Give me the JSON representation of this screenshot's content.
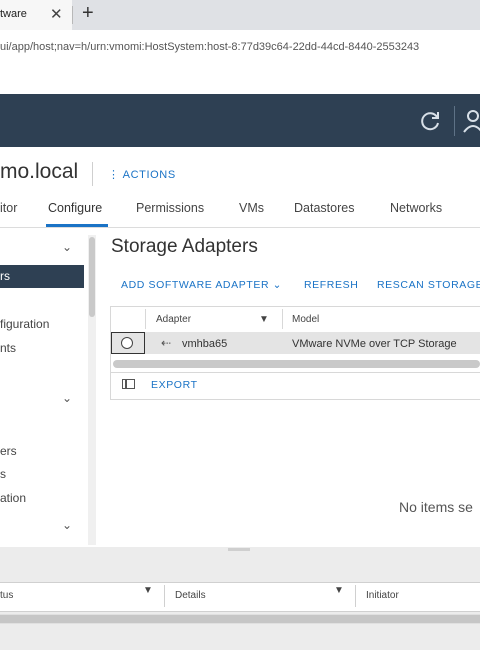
{
  "browser": {
    "tab_title": "tware",
    "tab_close": "✕",
    "new_tab": "+",
    "url": "ui/app/host;nav=h/urn:vmomi:HostSystem:host-8:77d39c64-22dd-44cd-8440-2553243"
  },
  "object": {
    "title": "mo.local",
    "actions_icon": "⋮",
    "actions_label": "ACTIONS"
  },
  "tabs": [
    {
      "label": "itor"
    },
    {
      "label": "Configure",
      "active": true
    },
    {
      "label": "Permissions"
    },
    {
      "label": "VMs"
    },
    {
      "label": "Datastores"
    },
    {
      "label": "Networks"
    }
  ],
  "left_nav": {
    "selected_label": "rs",
    "items": [
      "figuration",
      "nts",
      "ers",
      "s",
      "ation"
    ]
  },
  "page": {
    "title": "Storage Adapters",
    "toolbar": {
      "add_software_adapter": "ADD SOFTWARE ADAPTER ⌄",
      "refresh": "REFRESH",
      "rescan_storage": "RESCAN STORAGE"
    },
    "grid": {
      "columns": [
        "Adapter",
        "Model"
      ],
      "rows": [
        {
          "adapter": "vmhba65",
          "model": "VMware NVMe over TCP Storage"
        }
      ]
    },
    "export_label": "EXPORT",
    "empty_text": "No items se"
  },
  "bottom_panel": {
    "columns": [
      "tus",
      "Details",
      "Initiator"
    ]
  },
  "colors": {
    "header_bg": "#2e4053",
    "accent_blue": "#1a73c6"
  },
  "icons": {
    "refresh": "refresh-icon",
    "user": "user-icon",
    "filter": "filter-icon",
    "adapter": "adapter-arrow-icon",
    "export": "export-icon"
  }
}
